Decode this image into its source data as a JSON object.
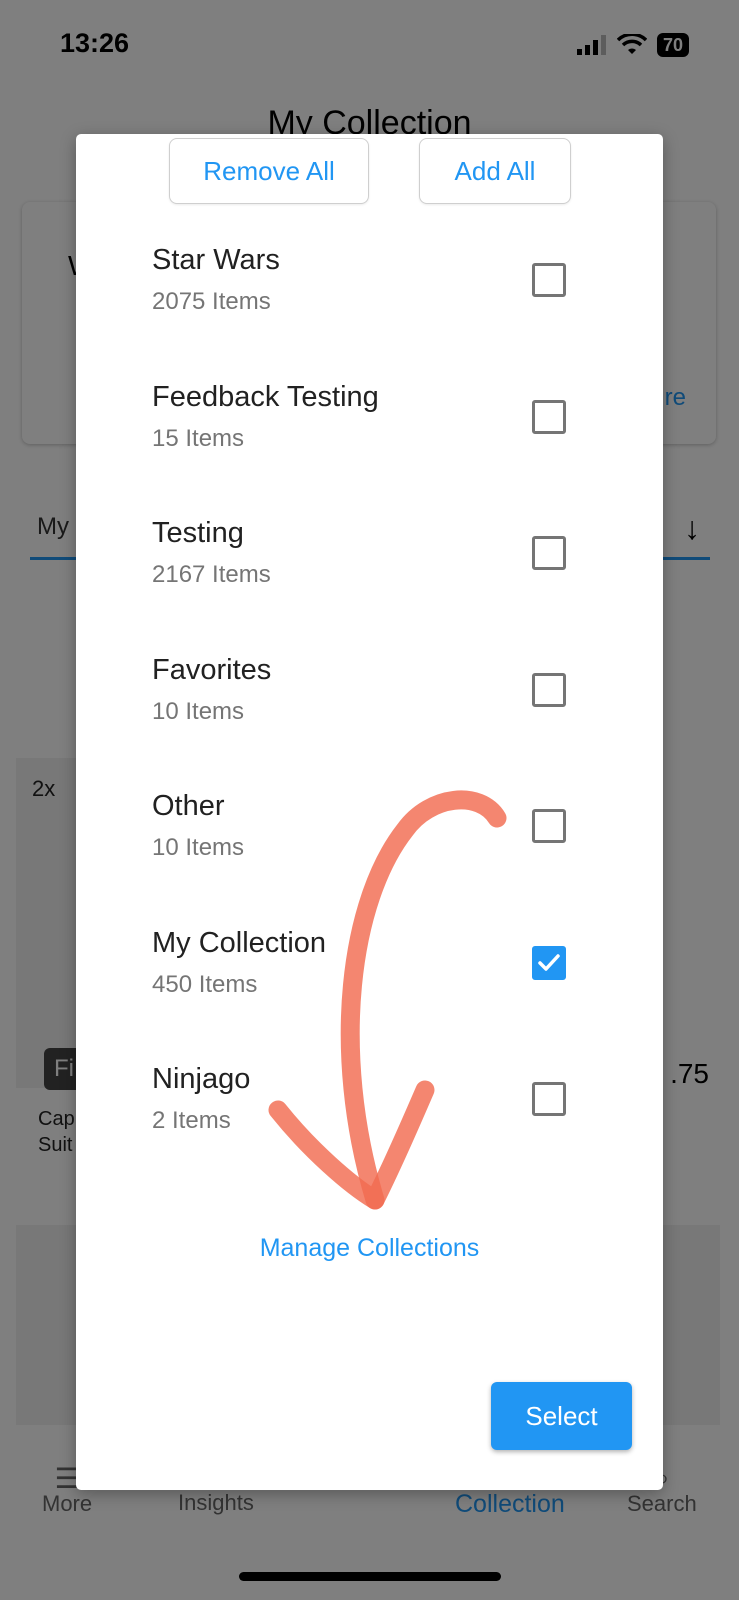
{
  "status_bar": {
    "time": "13:26",
    "battery": "70"
  },
  "background": {
    "title": "My Collection",
    "card_initial": "W",
    "card_link": "re",
    "tab_label": "My",
    "grid_badge": "2x",
    "grid_tag": "Fi",
    "grid_caption_1": "Cap",
    "grid_caption_2": "Suit",
    "grid_price": ".75"
  },
  "bottom_nav": {
    "items": [
      {
        "label": "More",
        "icon": "menu-icon"
      },
      {
        "label": "Insights",
        "icon": "insights-icon"
      },
      {
        "label": "Collection",
        "icon": "collection-icon"
      },
      {
        "label": "Search",
        "icon": "search-icon"
      }
    ],
    "active": "Collection"
  },
  "dialog": {
    "remove_all_label": "Remove All",
    "add_all_label": "Add All",
    "collections": [
      {
        "name": "Star Wars",
        "count": "2075 Items",
        "checked": false
      },
      {
        "name": "Feedback Testing",
        "count": "15 Items",
        "checked": false
      },
      {
        "name": "Testing",
        "count": "2167 Items",
        "checked": false
      },
      {
        "name": "Favorites",
        "count": "10 Items",
        "checked": false
      },
      {
        "name": "Other",
        "count": "10 Items",
        "checked": false
      },
      {
        "name": "My Collection",
        "count": "450 Items",
        "checked": true
      },
      {
        "name": "Ninjago",
        "count": "2 Items",
        "checked": false
      }
    ],
    "manage_link": "Manage Collections",
    "select_label": "Select"
  },
  "colors": {
    "accent": "#2196f3",
    "annotation": "#f26b50",
    "scrim": "rgba(0,0,0,0.5)"
  }
}
